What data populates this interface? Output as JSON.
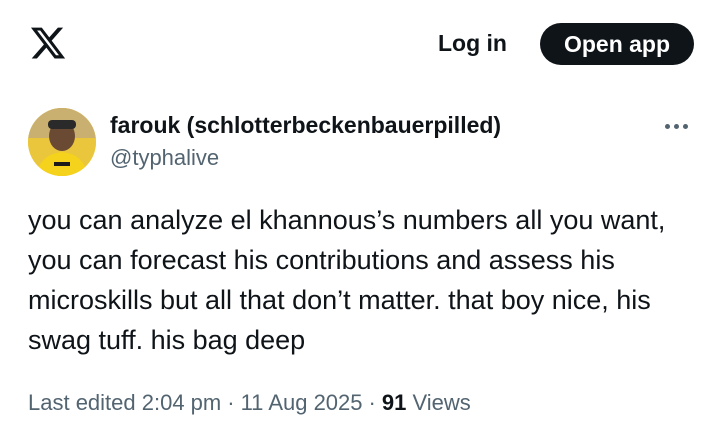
{
  "header": {
    "logo_icon": "x-logo-icon",
    "login_label": "Log in",
    "open_app_label": "Open app"
  },
  "tweet": {
    "display_name": "farouk (schlotterbeckenbauerpilled)",
    "handle": "@typhalive",
    "text": "you can analyze el khannous’s numbers all you want, you can forecast his contributions and assess his microskills but all that don’t matter. that boy nice, his swag tuff. his bag deep",
    "meta": {
      "edited_label": "Last edited 2:04 pm",
      "separator": "·",
      "date": "11 Aug 2025",
      "views_count": "91",
      "views_label": "Views"
    }
  },
  "colors": {
    "text_primary": "#0f1419",
    "text_secondary": "#536471",
    "button_dark": "#0f1419"
  }
}
